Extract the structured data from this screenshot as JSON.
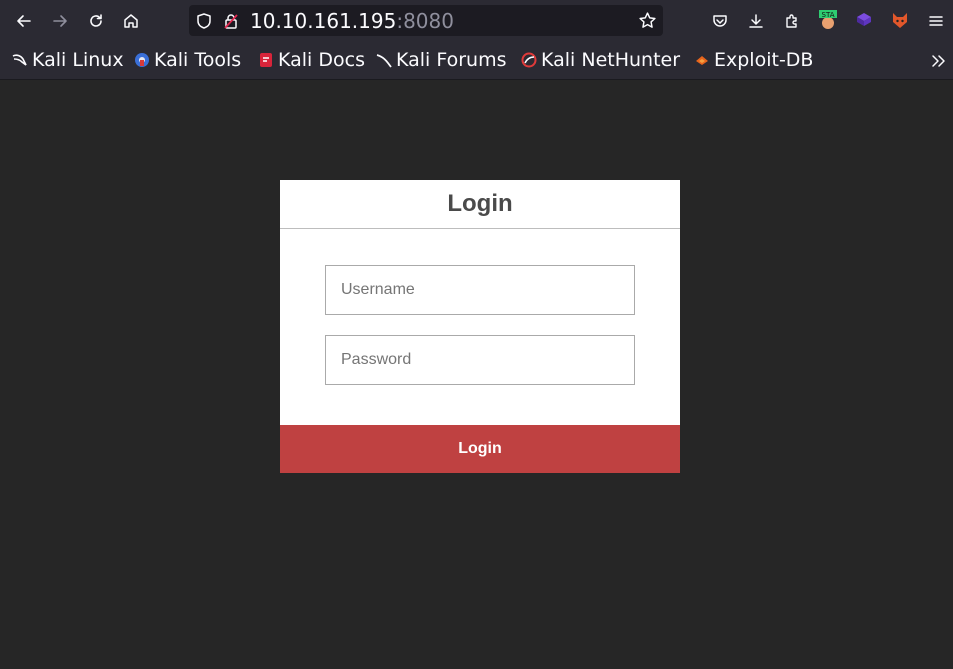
{
  "browser": {
    "url_host": "10.10.161.195",
    "url_port": ":8080",
    "extensions": [
      {
        "name": "sta-extension-icon",
        "badge": "STA"
      }
    ],
    "bookmarks": [
      {
        "label": "Kali Linux",
        "icon": "kali-dragon-icon"
      },
      {
        "label": "Kali Tools",
        "icon": "kali-tools-icon"
      },
      {
        "label": "Kali Docs",
        "icon": "kali-docs-icon"
      },
      {
        "label": "Kali Forums",
        "icon": "kali-forums-icon"
      },
      {
        "label": "Kali NetHunter",
        "icon": "kali-nethunter-icon"
      },
      {
        "label": "Exploit-DB",
        "icon": "exploit-db-icon"
      }
    ]
  },
  "login": {
    "title": "Login",
    "username_placeholder": "Username",
    "password_placeholder": "Password",
    "submit_label": "Login"
  },
  "colors": {
    "page_bg": "#262626",
    "button_bg": "#bf4141",
    "card_bg": "#ffffff"
  }
}
